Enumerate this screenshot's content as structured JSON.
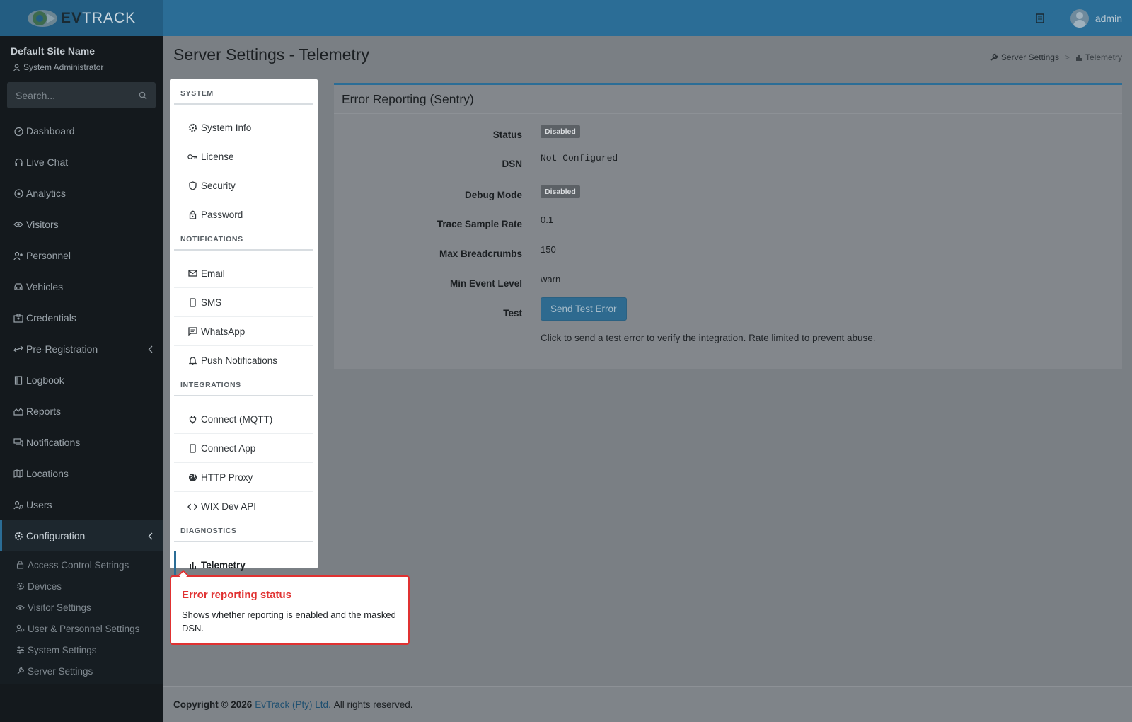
{
  "brand": {
    "name_bold": "EV",
    "name_light": "TRACK"
  },
  "header": {
    "user": "admin"
  },
  "sidebar": {
    "site_name": "Default Site Name",
    "role": "System Administrator",
    "search_placeholder": "Search...",
    "items": [
      {
        "label": "Dashboard",
        "icon": "gauge-icon"
      },
      {
        "label": "Live Chat",
        "icon": "headset-icon"
      },
      {
        "label": "Analytics",
        "icon": "target-icon"
      },
      {
        "label": "Visitors",
        "icon": "eye-icon"
      },
      {
        "label": "Personnel",
        "icon": "user-gear-icon"
      },
      {
        "label": "Vehicles",
        "icon": "car-icon"
      },
      {
        "label": "Credentials",
        "icon": "id-card-icon"
      },
      {
        "label": "Pre-Registration",
        "icon": "arrows-icon"
      },
      {
        "label": "Logbook",
        "icon": "book-icon"
      },
      {
        "label": "Reports",
        "icon": "chart-area-icon"
      },
      {
        "label": "Notifications",
        "icon": "chat-icon"
      },
      {
        "label": "Locations",
        "icon": "map-icon"
      },
      {
        "label": "Users",
        "icon": "users-gear-icon"
      },
      {
        "label": "Configuration",
        "icon": "gear-icon"
      }
    ],
    "config_subitems": [
      {
        "label": "Access Control Settings",
        "icon": "lock-icon"
      },
      {
        "label": "Devices",
        "icon": "gear-icon"
      },
      {
        "label": "Visitor Settings",
        "icon": "eye-icon"
      },
      {
        "label": "User & Personnel Settings",
        "icon": "users-gear-icon"
      },
      {
        "label": "System Settings",
        "icon": "sliders-icon"
      },
      {
        "label": "Server Settings",
        "icon": "wrench-icon"
      }
    ]
  },
  "page": {
    "title": "Server Settings - Telemetry",
    "breadcrumb": [
      "Server Settings",
      "Telemetry"
    ]
  },
  "settings_menu": {
    "sections": [
      {
        "title": "SYSTEM",
        "items": [
          "System Info",
          "License",
          "Security",
          "Password"
        ]
      },
      {
        "title": "NOTIFICATIONS",
        "items": [
          "Email",
          "SMS",
          "WhatsApp",
          "Push Notifications"
        ]
      },
      {
        "title": "INTEGRATIONS",
        "items": [
          "Connect (MQTT)",
          "Connect App",
          "HTTP Proxy",
          "WIX Dev API"
        ]
      },
      {
        "title": "DIAGNOSTICS",
        "items": [
          "Telemetry"
        ]
      }
    ]
  },
  "panel": {
    "title": "Error Reporting (Sentry)",
    "fields": {
      "status_label": "Status",
      "status_value": "Disabled",
      "dsn_label": "DSN",
      "dsn_value": "Not Configured",
      "debug_label": "Debug Mode",
      "debug_value": "Disabled",
      "trace_label": "Trace Sample Rate",
      "trace_value": "0.1",
      "breadcrumbs_label": "Max Breadcrumbs",
      "breadcrumbs_value": "150",
      "level_label": "Min Event Level",
      "level_value": "warn",
      "test_label": "Test",
      "test_button": "Send Test Error"
    },
    "help_text": "Click to send a test error to verify the integration. Rate limited to prevent abuse."
  },
  "footer": {
    "prefix": "Copyright © 2026",
    "company": "EvTrack (Pty) Ltd.",
    "suffix": "All rights reserved."
  },
  "tooltip": {
    "title": "Error reporting status",
    "body": "Shows whether reporting is enabled and the masked DSN."
  },
  "colors": {
    "brand": "#2b6d96",
    "sidebar": "#14191d",
    "tour_accent": "#e03131"
  }
}
